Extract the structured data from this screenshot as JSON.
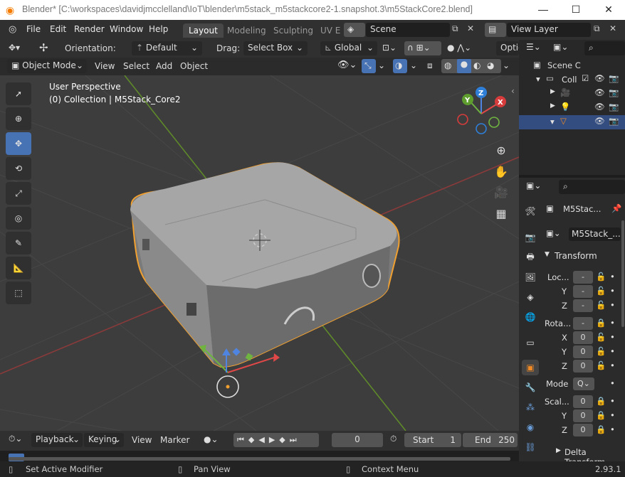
{
  "window": {
    "title": "Blender* [C:\\workspaces\\davidjmcclelland\\IoT\\blender\\m5stack_m5stackcore2-1.snapshot.3\\m5StackCore2.blend]",
    "minimize": "—",
    "maximize": "☐",
    "close": "✕"
  },
  "menus": [
    "File",
    "Edit",
    "Render",
    "Window",
    "Help"
  ],
  "workspaces": [
    "Layout",
    "Modeling",
    "Sculpting",
    "UV E"
  ],
  "active_workspace": "Layout",
  "scene": "Scene",
  "view_layer": "View Layer",
  "tool_header": {
    "orientation_label": "Orientation:",
    "orientation_value": "Default",
    "drag_label": "Drag:",
    "drag_value": "Select Box",
    "transform_orientation": "Global",
    "options": "Optio"
  },
  "viewport_header": {
    "mode": "Object Mode",
    "menus": [
      "View",
      "Select",
      "Add",
      "Object"
    ]
  },
  "viewport": {
    "perspective": "User Perspective",
    "collection_info": "(0) Collection | M5Stack_Core2"
  },
  "gizmo": {
    "x": "X",
    "y": "Y",
    "z": "Z"
  },
  "timeline": {
    "menus": [
      "Playback",
      "Keying",
      "View",
      "Marker"
    ],
    "current_frame": "0",
    "start_label": "Start",
    "start_value": "1",
    "end_label": "End",
    "end_value": "250"
  },
  "outliner": {
    "rows": [
      "Scene C",
      "Coll"
    ]
  },
  "properties": {
    "object_name": "M5Stac...",
    "data_name": "M5Stack_...",
    "section_transform": "Transform",
    "location_label": "Loc...",
    "loc_values": [
      "-",
      "-",
      "-"
    ],
    "axes": [
      "Y",
      "Z"
    ],
    "rotation_label": "Rota...",
    "rot_values": [
      "-",
      "0",
      "0",
      "0"
    ],
    "mode_label": "Mode",
    "mode_value": "Q",
    "scale_label": "Scal...",
    "scale_values": [
      "0",
      "0",
      "0"
    ],
    "delta_transform": "Delta Transform"
  },
  "status": {
    "left": "Set Active Modifier",
    "middle": "Pan View",
    "right": "Context Menu",
    "version": "2.93.1"
  },
  "colors": {
    "selection_active": "#4772b3",
    "object_outline": "#f0a030",
    "x_axis": "#c84a4a",
    "y_axis": "#7ea735"
  }
}
